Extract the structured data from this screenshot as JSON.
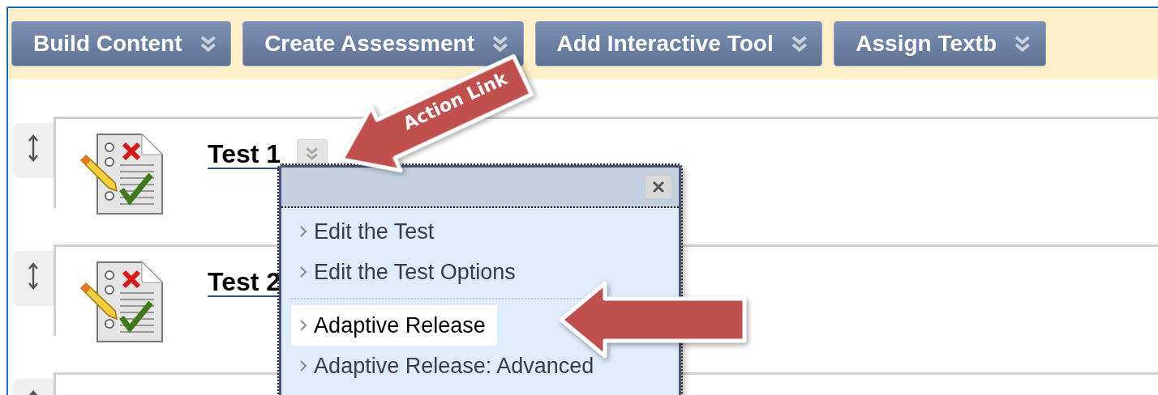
{
  "toolbar": {
    "buttons": [
      {
        "label": "Build Content"
      },
      {
        "label": "Create Assessment"
      },
      {
        "label": "Add Interactive Tool"
      },
      {
        "label": "Assign Textb"
      }
    ]
  },
  "rows": [
    {
      "title": "Test 1",
      "menu_open": true
    },
    {
      "title": "Test 2",
      "menu_open": false
    }
  ],
  "action_menu": {
    "items": [
      {
        "kind": "link",
        "label": "Edit the Test",
        "selected": false
      },
      {
        "kind": "link",
        "label": "Edit the Test Options",
        "selected": false
      },
      {
        "kind": "separator"
      },
      {
        "kind": "link",
        "label": "Adaptive Release",
        "selected": true
      },
      {
        "kind": "link",
        "label": "Adaptive Release: Advanced",
        "selected": false
      }
    ]
  },
  "callouts": [
    {
      "kind": "labeled",
      "label": "Action Link"
    },
    {
      "kind": "plain"
    }
  ]
}
